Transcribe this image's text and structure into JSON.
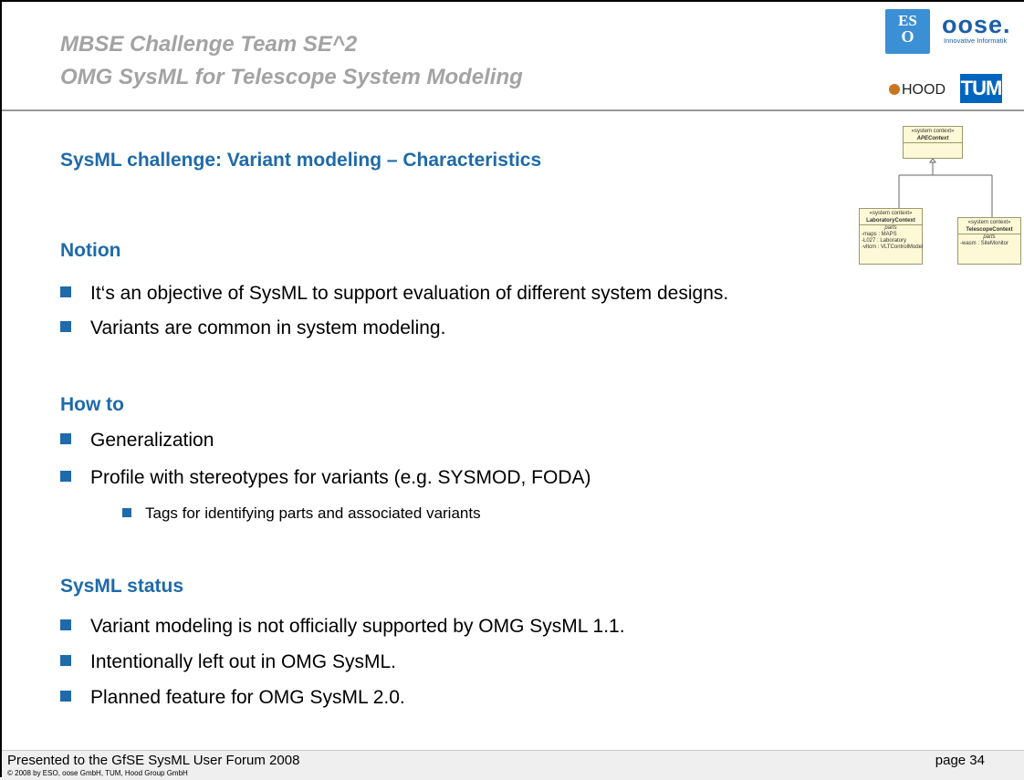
{
  "header": {
    "line1": "MBSE Challenge Team SE^2",
    "line2": "OMG SysML for Telescope System Modeling"
  },
  "logos": {
    "eso_top": "ES",
    "eso_bottom": "O",
    "oose": "oose.",
    "oose_sub": "Innovative Informatik",
    "hood": "HOOD",
    "tum": "TUM"
  },
  "title": "SysML challenge: Variant modeling – Characteristics",
  "diagram": {
    "root": {
      "stereotype": "«system context»",
      "name": "APEContext"
    },
    "left": {
      "stereotype": "«system context»",
      "name": "LaboratoryContext",
      "parts_label": "parts",
      "parts": [
        "-maps : MAPS",
        "-L027 : Laboratory",
        "-vltcm : VLTControlModel"
      ]
    },
    "right": {
      "stereotype": "«system context»",
      "name": "TelescopeContext",
      "parts_label": "parts",
      "parts": [
        "-wasm : SiteMonitor"
      ]
    }
  },
  "sections": {
    "notion": {
      "heading": "Notion",
      "bullets": [
        "It‘s an objective of SysML to support evaluation of different system designs.",
        "Variants are common in system modeling."
      ]
    },
    "howto": {
      "heading": "How to",
      "bullets": [
        "Generalization",
        "Profile with stereotypes for variants (e.g. SYSMOD, FODA)"
      ],
      "sub_bullets": [
        "Tags for identifying parts and associated variants"
      ]
    },
    "status": {
      "heading": "SysML status",
      "bullets": [
        "Variant modeling is not officially supported by OMG SysML 1.1.",
        "Intentionally left out in OMG SysML.",
        "Planned feature for OMG SysML 2.0."
      ]
    }
  },
  "footer": {
    "left": "Presented to the GfSE SysML User Forum 2008",
    "page": "page 34",
    "copyright": "© 2008 by ESO, oose GmbH, TUM, Hood Group GmbH"
  }
}
